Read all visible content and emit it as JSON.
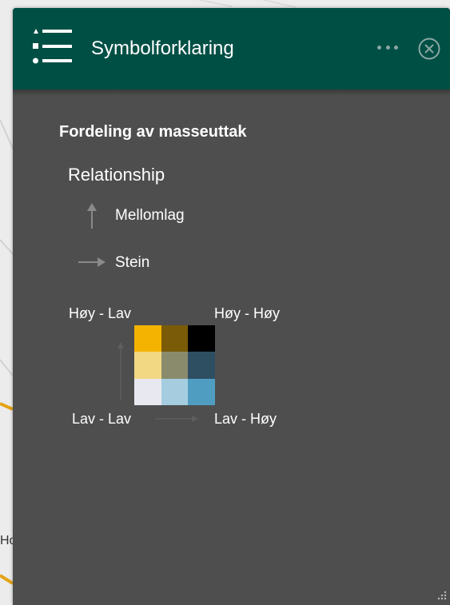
{
  "header": {
    "title": "Symbolforklaring",
    "legend_icon": "legend-list-icon",
    "more_icon": "more-dots-icon",
    "close_icon": "close-circle-icon"
  },
  "legend": {
    "layer_title": "Fordeling av masseuttak",
    "relationship_label": "Relationship",
    "vertical_field": "Mellomlag",
    "horizontal_field": "Stein",
    "corners": {
      "top_left": "Høy - Lav",
      "top_right": "Høy - Høy",
      "bottom_left": "Lav - Lav",
      "bottom_right": "Lav - Høy"
    },
    "grid_colors": [
      [
        "#f3b300",
        "#7a5b08",
        "#000000"
      ],
      [
        "#f3d884",
        "#8a8b6c",
        "#2e4e62"
      ],
      [
        "#e8e8f0",
        "#a5cddf",
        "#509dc2"
      ]
    ]
  },
  "map": {
    "edge_text": "Ho"
  },
  "colors": {
    "header": "#004f45",
    "panel": "#4e4e4e",
    "text": "#ffffff"
  }
}
